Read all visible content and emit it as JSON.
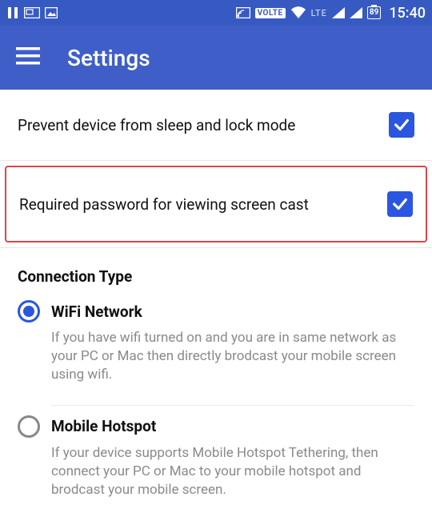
{
  "status": {
    "battery": "89",
    "clock": "15:40",
    "volte": "VOLTE",
    "lte": "LTE"
  },
  "header": {
    "title": "Settings"
  },
  "settings": {
    "prevent_sleep": {
      "label": "Prevent device from sleep and lock mode",
      "checked": true
    },
    "require_password": {
      "label": "Required password for viewing screen cast",
      "checked": true
    }
  },
  "connection": {
    "header": "Connection Type",
    "wifi": {
      "title": "WiFi Network",
      "desc": "If you have wifi turned on and you are in same network as your PC or Mac then directly brodcast your mobile screen using wifi.",
      "selected": true
    },
    "hotspot": {
      "title": "Mobile Hotspot",
      "desc": "If your device supports Mobile Hotspot Tethering, then connect your PC or Mac to your mobile hotspot and brodcast your mobile screen.",
      "selected": false
    }
  }
}
